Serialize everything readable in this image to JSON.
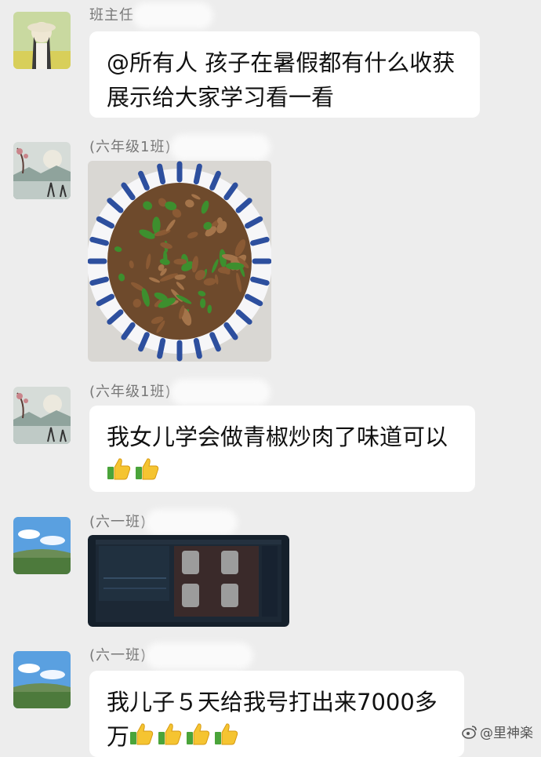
{
  "messages": [
    {
      "sender": "班主任",
      "text_lines": [
        "@所有人 孩子在暑假都有什么收获",
        "展示给大家学习看一看"
      ]
    },
    {
      "sender": "(六年级1班)",
      "image": "dish-photo"
    },
    {
      "sender": "(六年级1班)",
      "text_lines": [
        "我女儿学会做青椒炒肉了味道可以"
      ],
      "thumbs": 2
    },
    {
      "sender": "(六一班)",
      "image": "game-screenshot"
    },
    {
      "sender": "(六一班)",
      "text_lines": [
        "我儿子５天给我号打出来7000多",
        "万"
      ],
      "thumbs": 4
    }
  ],
  "watermark": "@里神楽",
  "icons": {
    "thumb": "thumbs-up-emoji",
    "weibo": "weibo-logo-icon"
  }
}
